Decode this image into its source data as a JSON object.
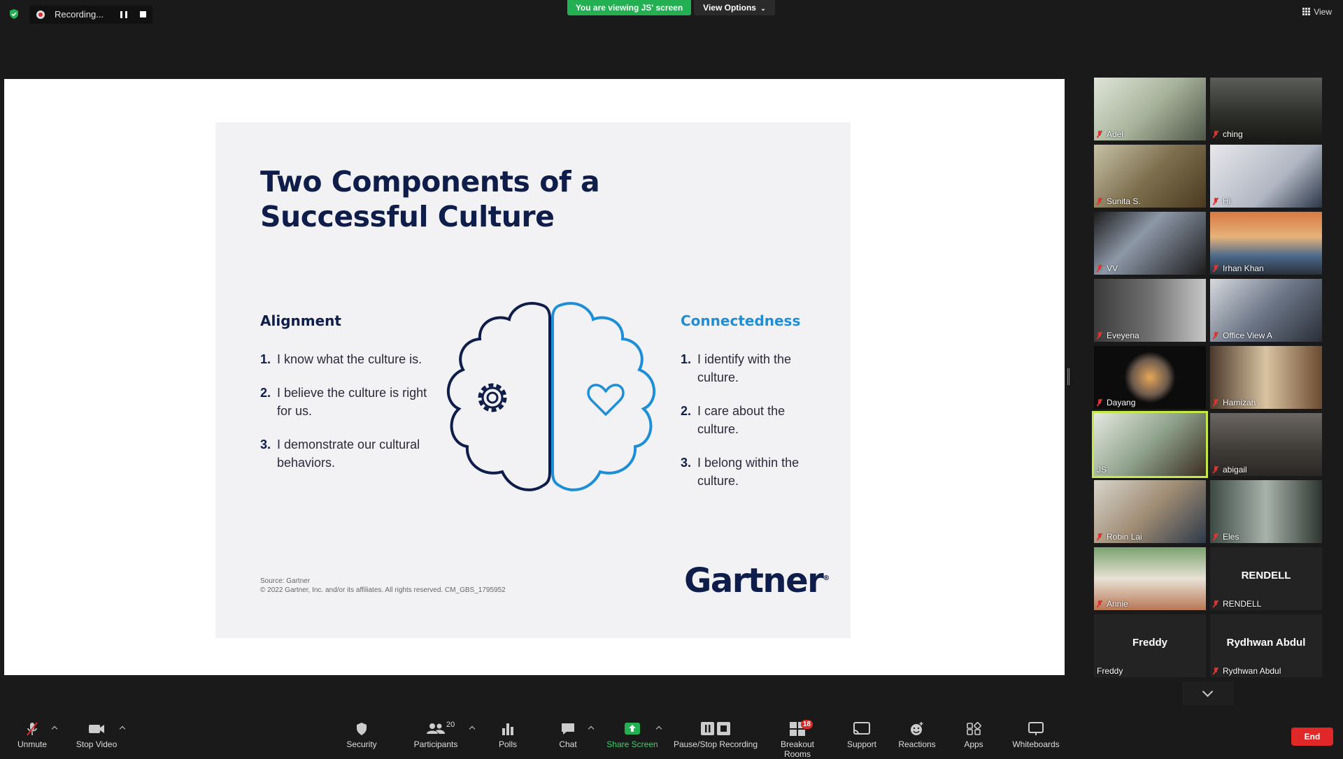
{
  "topbar": {
    "recording_label": "Recording...",
    "viewing_banner": "You are viewing JS' screen",
    "view_options_label": "View Options",
    "view_label": "View"
  },
  "slide": {
    "title_line1": "Two Components of a",
    "title_line2": "Successful Culture",
    "left_heading": "Alignment",
    "left_items": [
      {
        "num": "1.",
        "text": "I know what the culture is."
      },
      {
        "num": "2.",
        "text": "I believe the culture is right for us."
      },
      {
        "num": "3.",
        "text": "I demonstrate our cultural behaviors."
      }
    ],
    "right_heading": "Connectedness",
    "right_items": [
      {
        "num": "1.",
        "text": "I identify with the culture."
      },
      {
        "num": "2.",
        "text": "I care about the culture."
      },
      {
        "num": "3.",
        "text": "I belong within the culture."
      }
    ],
    "source_line1": "Source: Gartner",
    "source_line2": "© 2022 Gartner, Inc. and/or its affiliates. All rights reserved. CM_GBS_1795952",
    "logo": "Gartner",
    "logo_mark": "®",
    "colors": {
      "navy": "#0f1d4a",
      "blue": "#1e8fd6"
    }
  },
  "participants": [
    {
      "name": "Adel",
      "muted": true
    },
    {
      "name": "ching",
      "muted": true
    },
    {
      "name": "Sunita S.",
      "muted": true
    },
    {
      "name": "Hi",
      "muted": true
    },
    {
      "name": "VV",
      "muted": true
    },
    {
      "name": "Irhan Khan",
      "muted": true
    },
    {
      "name": "Eveyena",
      "muted": true
    },
    {
      "name": "Office View A",
      "muted": true
    },
    {
      "name": "Dayang",
      "muted": true
    },
    {
      "name": "Hamizah",
      "muted": true
    },
    {
      "name": "JS",
      "muted": false,
      "active": true
    },
    {
      "name": "abigail",
      "muted": true
    },
    {
      "name": "Robin Lai",
      "muted": true
    },
    {
      "name": "Eles",
      "muted": true
    },
    {
      "name": "Annie",
      "muted": true
    },
    {
      "name": "RENDELL",
      "muted": true,
      "big": "RENDELL"
    },
    {
      "name": "Freddy",
      "muted": false,
      "big": "Freddy"
    },
    {
      "name": "Rydhwan Abdul",
      "muted": true,
      "big": "Rydhwan Abdul"
    }
  ],
  "toolbar": {
    "unmute": "Unmute",
    "stop_video": "Stop Video",
    "security": "Security",
    "participants": "Participants",
    "participants_count": "20",
    "polls": "Polls",
    "chat": "Chat",
    "share_screen": "Share Screen",
    "pause_recording": "Pause/Stop Recording",
    "breakout_rooms": "Breakout Rooms",
    "breakout_count": "18",
    "support": "Support",
    "reactions": "Reactions",
    "apps": "Apps",
    "whiteboards": "Whiteboards",
    "end": "End"
  }
}
